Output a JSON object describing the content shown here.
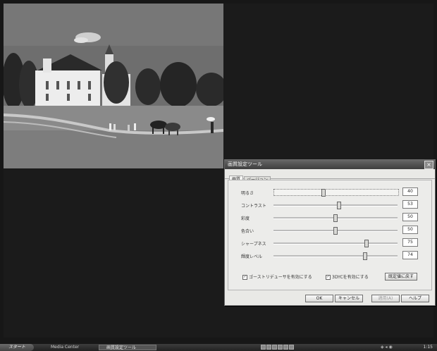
{
  "dialog": {
    "title": "画質設定ツール",
    "close_glyph": "×",
    "tabs": [
      {
        "label": "画質",
        "active": true
      },
      {
        "label": "バージョン",
        "active": false
      }
    ],
    "sliders": [
      {
        "label": "明るさ",
        "value": "40",
        "level": 0.4
      },
      {
        "label": "コントラスト",
        "value": "53",
        "level": 0.53
      },
      {
        "label": "彩度",
        "value": "50",
        "level": 0.5
      },
      {
        "label": "色合い",
        "value": "50",
        "level": 0.5
      },
      {
        "label": "シャープネス",
        "value": "75",
        "level": 0.75
      },
      {
        "label": "輝度レベル",
        "value": "74",
        "level": 0.74
      }
    ],
    "checkboxes": [
      {
        "label": "ゴーストリデューサを有効にする",
        "checked": true
      },
      {
        "label": "3DYCを有効にする",
        "checked": true
      }
    ],
    "reset_label": "既定値に戻す",
    "ok_label": "OK",
    "cancel_label": "キャンセル",
    "apply_label": "適用(A)",
    "help_label": "ヘルプ"
  },
  "taskbar": {
    "start_label": "スタート",
    "tasks": [
      {
        "label": "Media Center",
        "active": false
      },
      {
        "label": "画質設定ツール",
        "active": true
      }
    ],
    "clock": "1:15"
  },
  "colors": {
    "desktop": "#171717",
    "dialog_bg": "#e9e9e6",
    "titlebar": "#4a4a4a"
  }
}
